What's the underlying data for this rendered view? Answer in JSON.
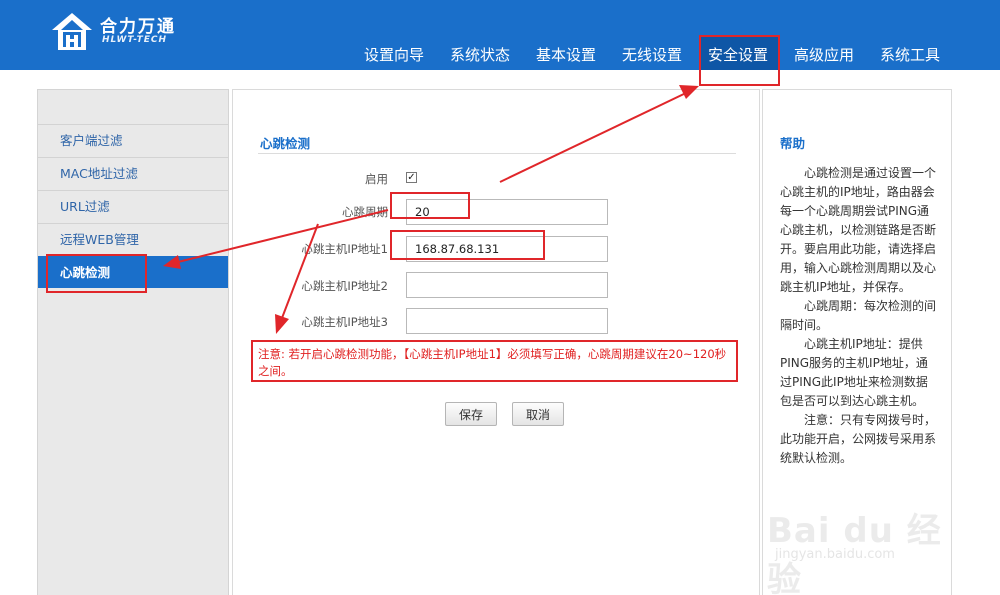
{
  "brand": {
    "name_cn": "合力万通",
    "name_en": "HLWT-TECH",
    "logo_icon": "house-logo-icon"
  },
  "nav": {
    "items": [
      "设置向导",
      "系统状态",
      "基本设置",
      "无线设置",
      "安全设置",
      "高级应用",
      "系统工具"
    ],
    "active": "安全设置"
  },
  "sidebar": {
    "items": [
      "客户端过滤",
      "MAC地址过滤",
      "URL过滤",
      "远程WEB管理",
      "心跳检测"
    ],
    "active": "心跳检测"
  },
  "form": {
    "title": "心跳检测",
    "enable_label": "启用",
    "enabled": true,
    "period_label": "心跳周期",
    "period_value": "20",
    "ip1_label": "心跳主机IP地址1",
    "ip1_value": "168.87.68.131",
    "ip2_label": "心跳主机IP地址2",
    "ip2_value": "",
    "ip3_label": "心跳主机IP地址3",
    "ip3_value": "",
    "notice": "注意: 若开启心跳检测功能，【心跳主机IP地址1】必须填写正确，心跳周期建议在20~120秒之间。",
    "save_label": "保存",
    "cancel_label": "取消"
  },
  "help": {
    "title": "帮助",
    "paragraphs": [
      "心跳检测是通过设置一个心跳主机的IP地址，路由器会每一个心跳周期尝试PING通心跳主机，以检测链路是否断开。要启用此功能，请选择启用，输入心跳检测周期以及心跳主机IP地址，并保存。",
      "心跳周期：每次检测的间隔时间。",
      "心跳主机IP地址：提供PING服务的主机IP地址，通过PING此IP地址来检测数据包是否可以到达心跳主机。",
      "注意：只有专网拨号时，此功能开启，公网拨号采用系统默认检测。"
    ]
  },
  "colors": {
    "header": "#1a6fca",
    "accent": "#1a6fca",
    "annotation": "#e0262a",
    "notice": "#e02020"
  },
  "watermark": {
    "big": "Bai du 经验",
    "small": "jingyan.baidu.com"
  }
}
